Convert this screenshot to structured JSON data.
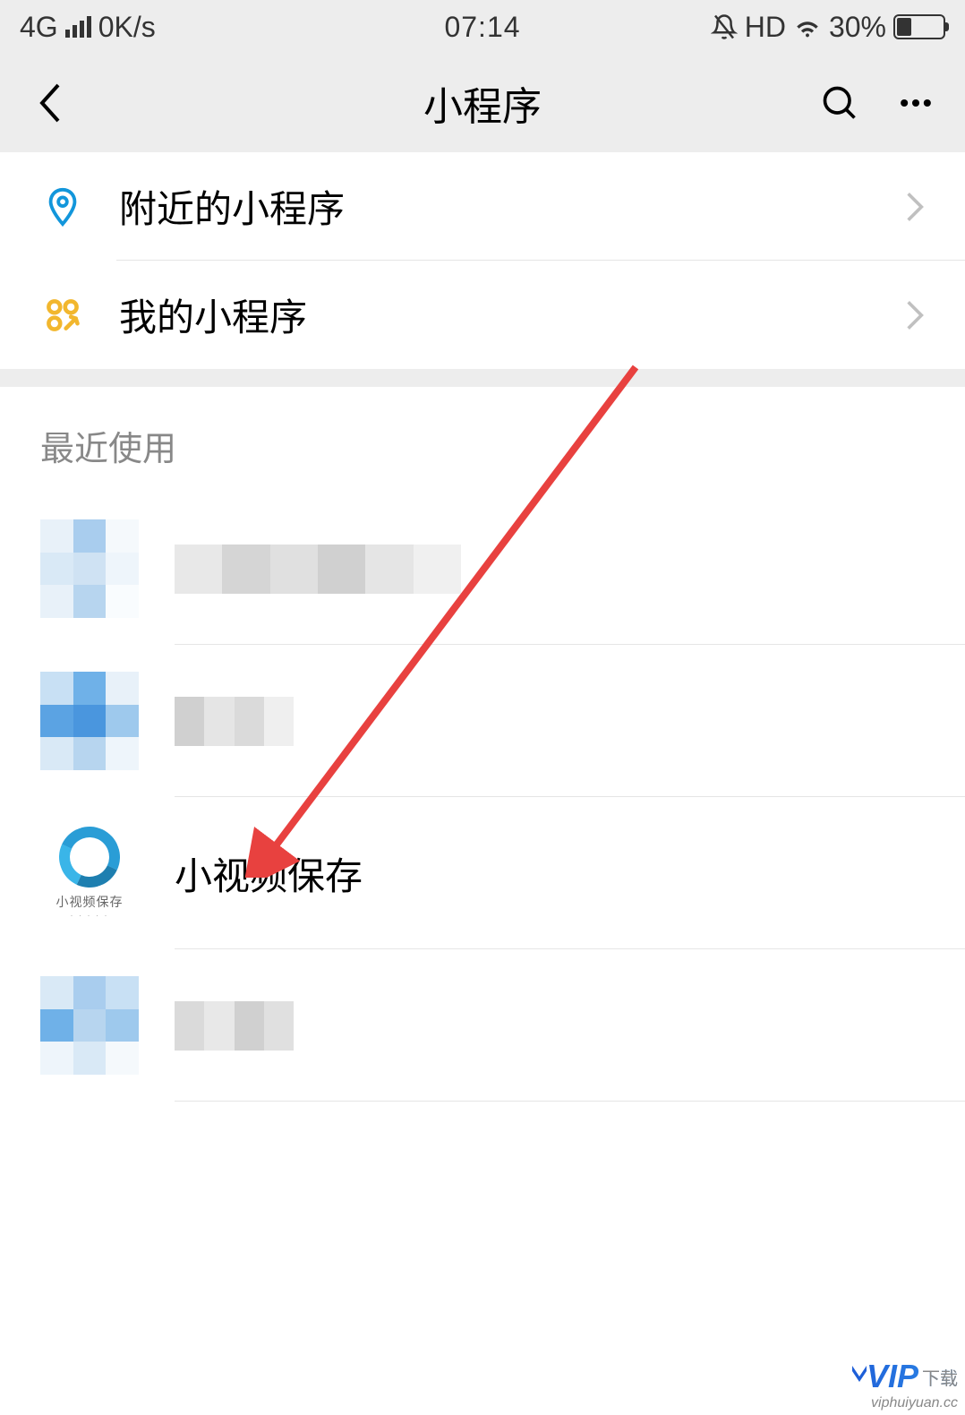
{
  "status_bar": {
    "network_type": "4G",
    "speed": "0K/s",
    "time": "07:14",
    "hd": "HD",
    "battery_percent": "30%"
  },
  "nav": {
    "title": "小程序"
  },
  "menu": {
    "items": [
      {
        "label": "附近的小程序",
        "icon": "location"
      },
      {
        "label": "我的小程序",
        "icon": "apps"
      }
    ]
  },
  "recent": {
    "header": "最近使用",
    "items": [
      {
        "label": "",
        "blurred": true
      },
      {
        "label": "",
        "blurred": true
      },
      {
        "label": "小视频保存",
        "icon_caption": "小视频保存",
        "blurred": false
      },
      {
        "label": "",
        "blurred": true
      }
    ]
  },
  "watermark": {
    "logo_text": "VIP",
    "logo_suffix": "下载",
    "url": "viphuiyuan.cc"
  },
  "annotation": {
    "arrow_color": "#e8413f"
  }
}
